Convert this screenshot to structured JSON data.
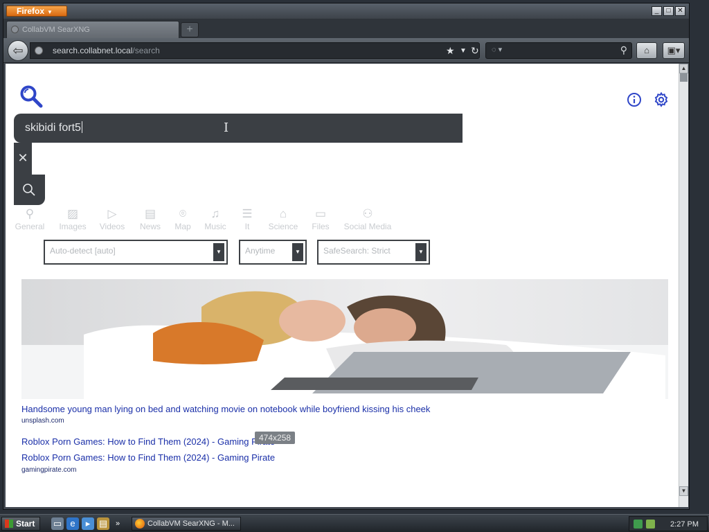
{
  "browser": {
    "menu_button": "Firefox",
    "tab_title": "CollabVM SearXNG",
    "url_host": "search.collabnet.local",
    "url_path": "/search",
    "window_controls": [
      "minimize-icon",
      "maximize-icon",
      "close-icon"
    ]
  },
  "search": {
    "query": "skibidi fort5",
    "clear_symbol": "✕"
  },
  "categories": [
    {
      "label": "General",
      "icon": "magnifier-icon"
    },
    {
      "label": "Images",
      "icon": "image-icon"
    },
    {
      "label": "Videos",
      "icon": "play-icon"
    },
    {
      "label": "News",
      "icon": "newspaper-icon"
    },
    {
      "label": "Map",
      "icon": "map-pin-icon"
    },
    {
      "label": "Music",
      "icon": "music-note-icon"
    },
    {
      "label": "It",
      "icon": "layers-icon"
    },
    {
      "label": "Science",
      "icon": "school-icon"
    },
    {
      "label": "Files",
      "icon": "files-icon"
    },
    {
      "label": "Social Media",
      "icon": "people-icon"
    }
  ],
  "filters": {
    "language": "Auto-detect [auto]",
    "time_range": "Anytime",
    "safesearch": "SafeSearch: Strict"
  },
  "results": [
    {
      "title": "Handsome young man lying on bed and watching movie on notebook while boyfriend kissing his cheek",
      "host": "unsplash.com"
    },
    {
      "title": "Roblox Porn Games: How to Find Them (2024) - Gaming Pirate",
      "host": ""
    },
    {
      "title": "Roblox Porn Games: How to Find Them (2024) - Gaming Pirate",
      "host": "gamingpirate.com"
    }
  ],
  "tooltip": "474x258",
  "taskbar": {
    "start_label": "Start",
    "task_label": "CollabVM SearXNG - M...",
    "clock": "2:27 PM"
  },
  "colors": {
    "accent_blue": "#2f46c8",
    "searchbar_bg": "#3b3f44",
    "link": "#1a2fa8"
  }
}
